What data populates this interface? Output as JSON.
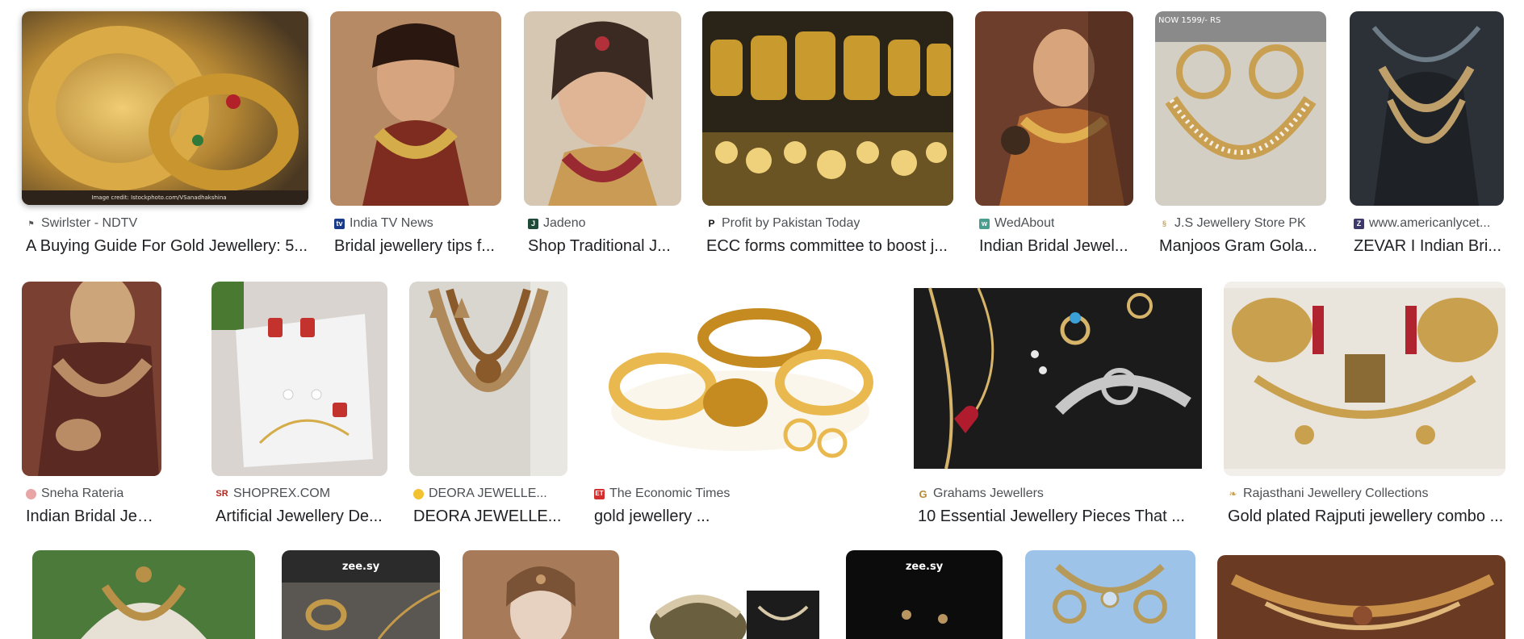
{
  "results": [
    {
      "source": "Swirlster - NDTV",
      "title": "A Buying Guide For Gold Jewellery: 5...",
      "favicon": "swirlster-icon",
      "fav_color": "#555555",
      "fav_glyph": "‡",
      "colors": [
        "#5b4325",
        "#b28533",
        "#e3c06b",
        "#7a5626"
      ],
      "caption": "Image credit: Istockphoto.com/VSanadhakshina"
    },
    {
      "source": "India TV News",
      "title": "Bridal jewellery tips f...",
      "favicon": "india-tv-icon",
      "fav_color": "#1a3a8a",
      "fav_glyph": "tv",
      "colors": [
        "#b58a65",
        "#7e2c1f",
        "#c8a046",
        "#3a1f16"
      ]
    },
    {
      "source": "Jadeno",
      "title": "Shop Traditional J...",
      "favicon": "jadeno-icon",
      "fav_color": "#1f4a38",
      "fav_glyph": "J",
      "colors": [
        "#d6c7b2",
        "#c9a486",
        "#8a4a32",
        "#c99b55"
      ]
    },
    {
      "source": "Profit by Pakistan Today",
      "title": "ECC forms committee to boost j...",
      "favicon": "profit-icon",
      "fav_color": "#111111",
      "fav_glyph": "P",
      "colors": [
        "#2a2418",
        "#c99a2e",
        "#efd07b",
        "#6b5423"
      ]
    },
    {
      "source": "WedAbout",
      "title": "Indian Bridal Jewel...",
      "favicon": "wedabout-icon",
      "fav_color": "#4a9e8f",
      "fav_glyph": "w",
      "colors": [
        "#6e3e2c",
        "#d8a47b",
        "#b46a31",
        "#3f2a1e"
      ]
    },
    {
      "source": "J.S Jewellery Store PK",
      "title": "Manjoos Gram Gola...",
      "favicon": "js-jewellery-icon",
      "fav_color": "#c8a15a",
      "fav_glyph": "s",
      "colors": [
        "#8a8a8a",
        "#d4cfc5",
        "#c9a052",
        "#b9b3a8"
      ],
      "price_line": "NOW 1599/- RS"
    },
    {
      "source": "www.americanlycet...",
      "title": "ZEVAR I Indian Bri...",
      "favicon": "americanlycet-icon",
      "fav_color": "#3d3a6b",
      "fav_glyph": "Z",
      "colors": [
        "#2c3138",
        "#bfa06a",
        "#6d7c86",
        "#1e2226"
      ]
    },
    {
      "source": "Sneha Rateria",
      "title": "Indian Bridal Jewell...",
      "favicon": "sneha-rateria-icon",
      "fav_color": "#e7a5a5",
      "fav_glyph": "",
      "colors": [
        "#7a4032",
        "#b98c66",
        "#5a2a22",
        "#cda57a"
      ]
    },
    {
      "source": "SHOPREX.COM",
      "title": "Artificial Jewellery De...",
      "favicon": "shoprex-icon",
      "fav_color": "#b3241c",
      "fav_glyph": "SR",
      "colors": [
        "#f3f3f3",
        "#d9d4cf",
        "#c4322d",
        "#4a7a32"
      ]
    },
    {
      "source": "DEORA JEWELLE...",
      "title": "DEORA JEWELLE...",
      "favicon": "deora-icon",
      "fav_color": "#2f8a3a",
      "fav_glyph": "",
      "colors": [
        "#d8d6cf",
        "#b0895a",
        "#8b5a2a",
        "#e8e7e2"
      ]
    },
    {
      "source": "The Economic Times",
      "title": "gold jewellery ...",
      "favicon": "economic-times-icon",
      "fav_color": "#d32f2f",
      "fav_glyph": "ET",
      "colors": [
        "#ffffff",
        "#e9b950",
        "#c58b20",
        "#fbf6ec"
      ]
    },
    {
      "source": "Grahams Jewellers",
      "title": "10 Essential Jewellery Pieces That ...",
      "favicon": "grahams-icon",
      "fav_color": "#ffffff",
      "fav_glyph": "G",
      "colors": [
        "#1b1b1b",
        "#d6b46a",
        "#c7c7c7",
        "#b01c2e"
      ]
    },
    {
      "source": "Rajasthani Jewellery Collections",
      "title": "Gold plated Rajputi jewellery combo ...",
      "favicon": "rajasthani-icon",
      "fav_color": "#ffffff",
      "fav_glyph": "❧",
      "colors": [
        "#f2efeb",
        "#c9a04d",
        "#b02430",
        "#8a6a35"
      ]
    },
    {
      "colors": [
        "#4b7a3a",
        "#e6e0d5",
        "#b89048",
        "#6a8d4e"
      ]
    },
    {
      "colors": [
        "#2b2b2b",
        "#5a5752",
        "#c39a4a",
        "#1d1d1d"
      ],
      "brand": "zee.sy"
    },
    {
      "colors": [
        "#a77a5a",
        "#e7d2c2",
        "#c69a6a",
        "#7a5235"
      ]
    },
    {
      "colors": [
        "#ffffff",
        "#d7c9a8",
        "#6a5f3e",
        "#1c1c1c"
      ]
    },
    {
      "colors": [
        "#0c0c0c",
        "#2a2a2a",
        "#b89560",
        "#111111"
      ],
      "brand": "zee.sy"
    },
    {
      "colors": [
        "#9ec3e8",
        "#cfe0f2",
        "#b69a5a",
        "#7ea6d2"
      ]
    },
    {
      "colors": [
        "#6a3a22",
        "#c9904a",
        "#8c4e2e",
        "#e0b77a"
      ]
    }
  ]
}
